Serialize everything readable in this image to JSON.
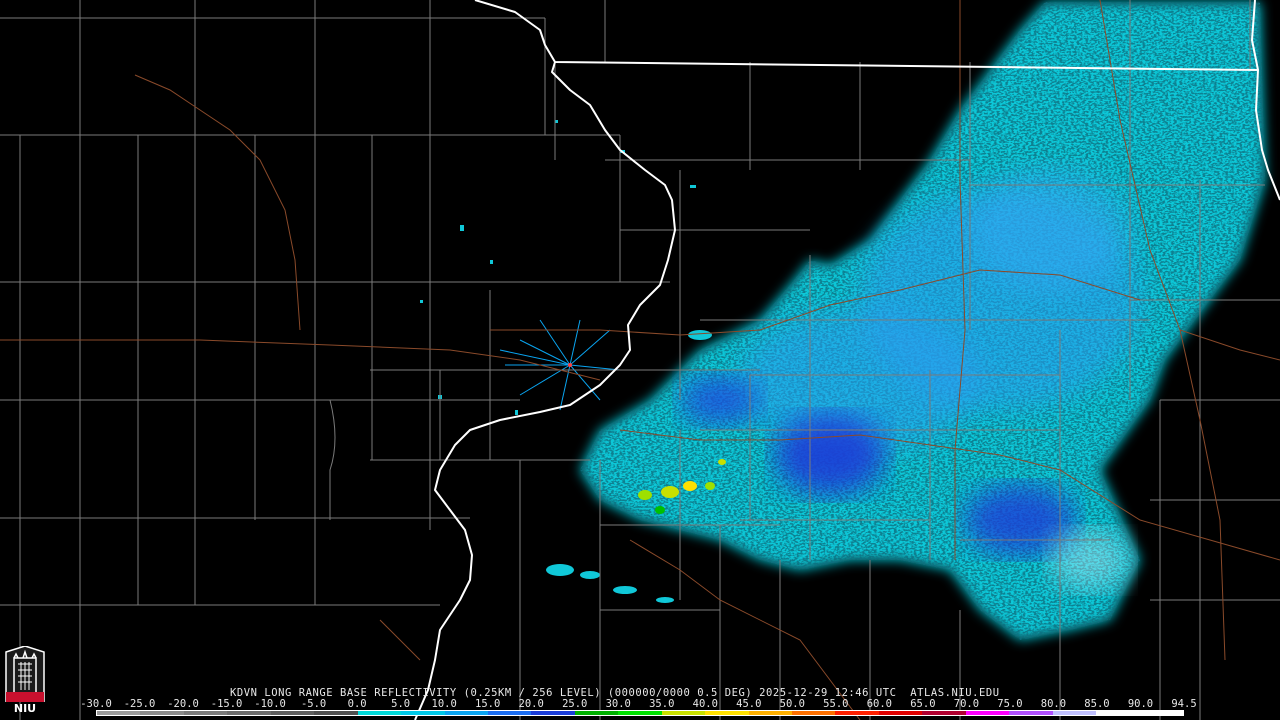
{
  "product": {
    "caption": "KDVN LONG RANGE BASE REFLECTIVITY (0.25KM / 256 LEVEL) (000000/0000 0.5 DEG) 2025-12-29 12:46 UTC  ATLAS.NIU.EDU"
  },
  "scale": {
    "ticks": [
      "-30.0",
      "-25.0",
      "-20.0",
      "-15.0",
      "-10.0",
      "-5.0",
      "0.0",
      "5.0",
      "10.0",
      "15.0",
      "20.0",
      "25.0",
      "30.0",
      "35.0",
      "40.0",
      "45.0",
      "50.0",
      "55.0",
      "60.0",
      "65.0",
      "70.0",
      "75.0",
      "80.0",
      "85.0",
      "90.0",
      "94.5"
    ],
    "colors": [
      "#9a9a9a",
      "#8a8a8a",
      "#7a7a7a",
      "#6c6c6c",
      "#5e5e5e",
      "#4f4f4f",
      "#00d8d8",
      "#00c8e8",
      "#0aa4f0",
      "#1a6cf0",
      "#1a3cd8",
      "#00b000",
      "#00e000",
      "#c8e000",
      "#ffe000",
      "#ffb000",
      "#ff7000",
      "#ff2000",
      "#e00000",
      "#b00030",
      "#ff00ff",
      "#b050ff",
      "#c0c0ff",
      "#ffffff",
      "#ffffff"
    ]
  },
  "logo": {
    "text": "NIU",
    "color": "#c8102e"
  }
}
